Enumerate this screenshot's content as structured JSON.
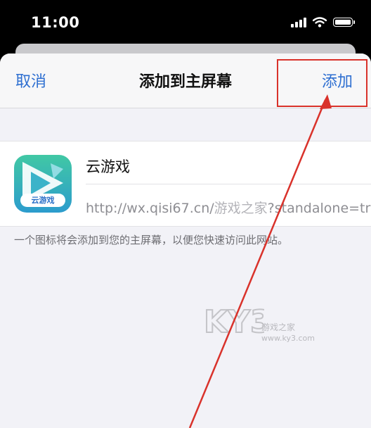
{
  "status_bar": {
    "time": "11:00"
  },
  "nav": {
    "cancel_label": "取消",
    "title": "添加到主屏幕",
    "add_label": "添加"
  },
  "app": {
    "icon_label": "云游戏",
    "name": "云游戏",
    "url_prefix": "http://wx.qisi67.cn/",
    "url_watermark": "游戏之家",
    "url_suffix": "?standalone=true"
  },
  "footnote": "一个图标将会添加到您的主屏幕，以便您快速访问此网站。",
  "watermark": {
    "logo": "KY3",
    "site": "游戏之家",
    "domain": "www.ky3.com"
  },
  "colors": {
    "accent": "#2e6fd1",
    "annotation": "#d9322b",
    "icon_top": "#41c8a4",
    "icon_bottom": "#2c9ccd"
  },
  "icons": [
    "signal-icon",
    "wifi-icon",
    "battery-icon",
    "app-play-icon"
  ]
}
